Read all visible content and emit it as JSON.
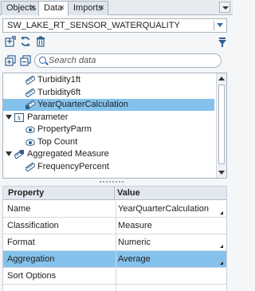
{
  "tabs": [
    {
      "label": "Objects",
      "active": false
    },
    {
      "label": "Data",
      "active": true
    },
    {
      "label": "Imports",
      "active": false
    }
  ],
  "tab_close_glyph": "×",
  "datasource": {
    "selected": "SW_LAKE_RT_SENSOR_WATERQUALITY"
  },
  "search": {
    "placeholder": "Search data",
    "value": ""
  },
  "tree": {
    "items": [
      {
        "label": "Turbidity1ft",
        "type": "measure-icon",
        "selected": false
      },
      {
        "label": "Turbidity6ft",
        "type": "measure-icon",
        "selected": false
      },
      {
        "label": "YearQuarterCalculation",
        "type": "calculated-item-icon",
        "selected": true
      },
      {
        "label": "Parameter",
        "type": "group-icon",
        "selected": false
      },
      {
        "label": "PropertyParm",
        "type": "parameter-icon",
        "selected": false
      },
      {
        "label": "Top Count",
        "type": "parameter-icon",
        "selected": false
      },
      {
        "label": "Aggregated Measure",
        "type": "group-icon",
        "selected": false
      },
      {
        "label": "FrequencyPercent",
        "type": "measure-icon",
        "selected": false
      }
    ]
  },
  "properties": {
    "header": {
      "property": "Property",
      "value": "Value"
    },
    "rows": [
      {
        "name": "Name",
        "value": "YearQuarterCalculation",
        "selected": false,
        "editable": true
      },
      {
        "name": "Classification",
        "value": "Measure",
        "selected": false,
        "editable": false
      },
      {
        "name": "Format",
        "value": "Numeric",
        "selected": false,
        "editable": true
      },
      {
        "name": "Aggregation",
        "value": "Average",
        "selected": true,
        "editable": true
      },
      {
        "name": "Sort Options",
        "value": "",
        "selected": false,
        "editable": false
      },
      {
        "name": "",
        "value": "",
        "selected": false,
        "editable": false
      }
    ]
  },
  "colors": {
    "selection": "#84c2ec",
    "accent": "#2f6aa3"
  }
}
